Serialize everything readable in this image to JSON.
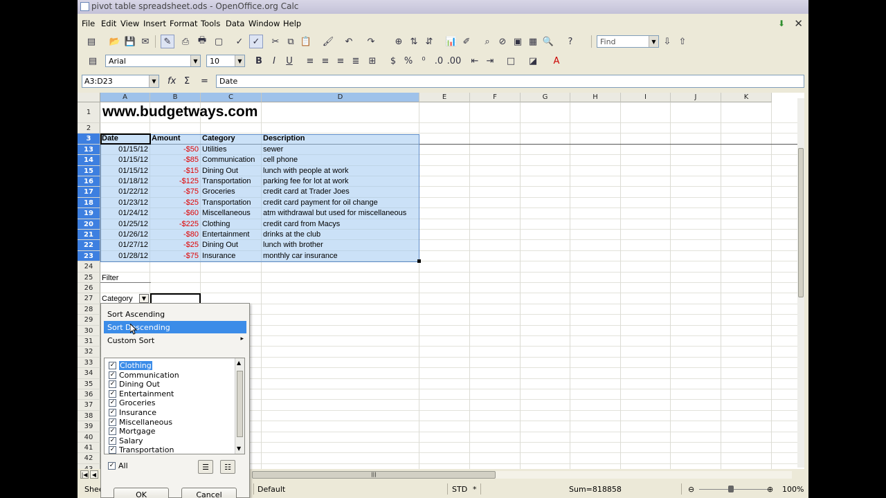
{
  "window": {
    "title": "pivot table spreadsheet.ods - OpenOffice.org Calc"
  },
  "menu": {
    "items": [
      "File",
      "Edit",
      "View",
      "Insert",
      "Format",
      "Tools",
      "Data",
      "Window",
      "Help"
    ]
  },
  "toolbar": {
    "find_placeholder": "Find",
    "font_name": "Arial",
    "font_size": "10"
  },
  "formula_bar": {
    "name_box": "A3:D23",
    "content": "Date"
  },
  "columns": [
    "A",
    "B",
    "C",
    "D",
    "E",
    "F",
    "G",
    "H",
    "I",
    "J",
    "K"
  ],
  "rows": [
    "1",
    "2",
    "3",
    "13",
    "14",
    "15",
    "16",
    "17",
    "18",
    "19",
    "20",
    "21",
    "22",
    "23",
    "24",
    "25",
    "26",
    "27",
    "28",
    "29",
    "30",
    "31",
    "32",
    "33",
    "34",
    "35",
    "36",
    "37",
    "38",
    "39",
    "40",
    "41",
    "42",
    "43"
  ],
  "sheet": {
    "url_text": "www.budgetways.com",
    "headers": [
      "Date",
      "Amount",
      "Category",
      "Description"
    ],
    "data": [
      [
        "01/15/12",
        "-$50",
        "Utilities",
        "sewer"
      ],
      [
        "01/15/12",
        "-$85",
        "Communication",
        "cell phone"
      ],
      [
        "01/15/12",
        "-$15",
        "Dining Out",
        "lunch with people at work"
      ],
      [
        "01/18/12",
        "-$125",
        "Transportation",
        "parking fee for lot at work"
      ],
      [
        "01/22/12",
        "-$75",
        "Groceries",
        "credit card at Trader Joes"
      ],
      [
        "01/23/12",
        "-$25",
        "Transportation",
        "credit card payment for oil change"
      ],
      [
        "01/24/12",
        "-$60",
        "Miscellaneous",
        "atm withdrawal but used for miscellaneous"
      ],
      [
        "01/25/12",
        "-$225",
        "Clothing",
        "credit card from Macys"
      ],
      [
        "01/26/12",
        "-$80",
        "Entertainment",
        "drinks at the club"
      ],
      [
        "01/27/12",
        "-$25",
        "Dining Out",
        "lunch with brother"
      ],
      [
        "01/28/12",
        "-$75",
        "Insurance",
        "monthly car insurance"
      ]
    ],
    "filter_label": "Filter",
    "category_label": "Category"
  },
  "filter_popup": {
    "sort_ascending": "Sort Ascending",
    "sort_descending": "Sort Descending",
    "custom_sort": "Custom Sort",
    "items": [
      {
        "label": "Clothing",
        "checked": true
      },
      {
        "label": "Communication",
        "checked": true
      },
      {
        "label": "Dining Out",
        "checked": true
      },
      {
        "label": "Entertainment",
        "checked": true
      },
      {
        "label": "Groceries",
        "checked": true
      },
      {
        "label": "Insurance",
        "checked": true
      },
      {
        "label": "Miscellaneous",
        "checked": true
      },
      {
        "label": "Mortgage",
        "checked": true
      },
      {
        "label": "Salary",
        "checked": true
      },
      {
        "label": "Transportation",
        "checked": true
      }
    ],
    "all_label": "All",
    "ok_label": "OK",
    "cancel_label": "Cancel"
  },
  "status": {
    "sheet_tab": "Shee",
    "page_style": "Default",
    "mode": "STD",
    "modified": "*",
    "sum": "Sum=818858",
    "zoom": "100%"
  },
  "colors": {
    "selection": "#a0c8f0",
    "selected_row_header": "#3d7fe0",
    "negative_value": "#e00000",
    "highlight": "#3b8ce8"
  }
}
